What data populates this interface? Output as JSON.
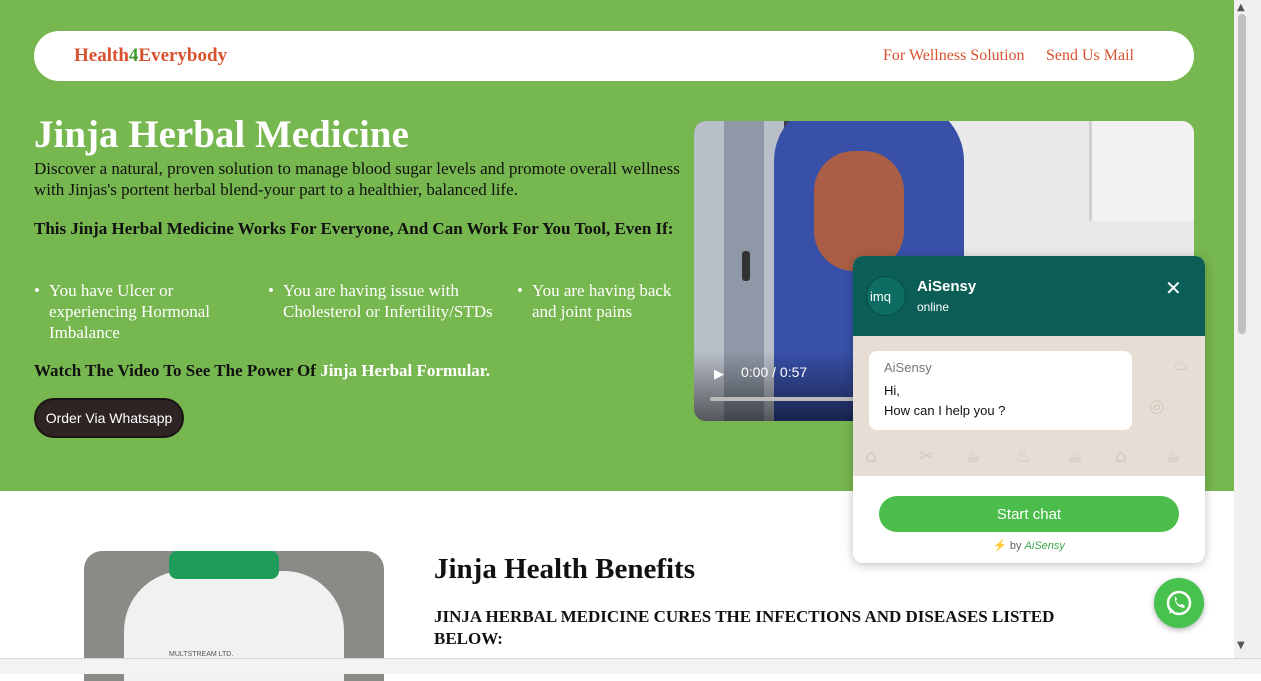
{
  "colors": {
    "hero_bg": "#77b74f",
    "accent": "#d9522f",
    "chat_header": "#0b5e55",
    "whatsapp_green": "#48c24e"
  },
  "nav": {
    "logo_h": "H",
    "logo_ealth": "ealth",
    "logo_4": "4",
    "logo_everybody": "Everybody",
    "links": [
      "For Wellness Solution",
      "Send Us Mail"
    ]
  },
  "hero": {
    "title": "Jinja Herbal Medicine",
    "description": "Discover a natural, proven solution to manage blood sugar levels and promote overall wellness with Jinjas's portent herbal blend-your part to a healthier, balanced life.",
    "subheading": "This Jinja Herbal Medicine Works For Everyone, And Can Work For You Tool, Even If:",
    "conditions": [
      "You have Ulcer or experiencing Hormonal Imbalance",
      "You are having issue with Cholesterol or Infertility/STDs",
      "You are having back and joint pains"
    ],
    "watch_prefix": "Watch The Video To See The Power Of ",
    "watch_highlight": "Jinja Herbal Formular.",
    "order_button": "Order Via Whatsapp"
  },
  "video": {
    "time": "0:00 / 0:57",
    "play_icon": "play-icon",
    "progress": 0
  },
  "benefits": {
    "title": "Jinja Health Benefits",
    "subtitle": "JINJA HERBAL MEDICINE CURES THE INFECTIONS AND DISEASES LISTED BELOW:",
    "image_label": "MULTSTREAM LTD."
  },
  "chat": {
    "name": "AiSensy",
    "status": "online",
    "avatar_alt": "imq",
    "close_icon": "close-icon",
    "message_sender": "AiSensy",
    "message_text": "Hi,\nHow can I help you ?",
    "start_button": "Start chat",
    "powered_by": "by",
    "powered_brand": "AiSensy"
  }
}
